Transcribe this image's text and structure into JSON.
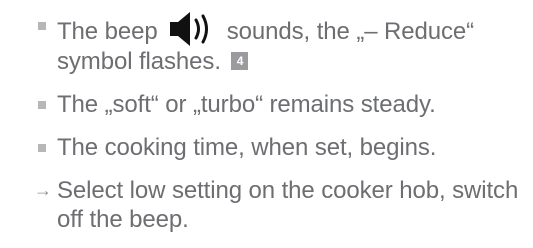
{
  "items": [
    {
      "marker": "square",
      "text_before": "The beep",
      "icon": "speaker-beep-icon",
      "text_after": " sounds, the „– Reduce“ symbol flashes.",
      "badge": "4"
    },
    {
      "marker": "square",
      "text": "The „soft“ or „turbo“ remains steady."
    },
    {
      "marker": "square",
      "text": "The cooking time, when set, begins."
    },
    {
      "marker": "arrow",
      "marker_glyph": "→",
      "text": "Select low setting on the cooker hob, switch off the beep."
    }
  ],
  "colors": {
    "text": "#6d6e71",
    "bullet": "#b6b7b9",
    "badge_bg": "#9a9b9e",
    "icon": "#111111"
  }
}
